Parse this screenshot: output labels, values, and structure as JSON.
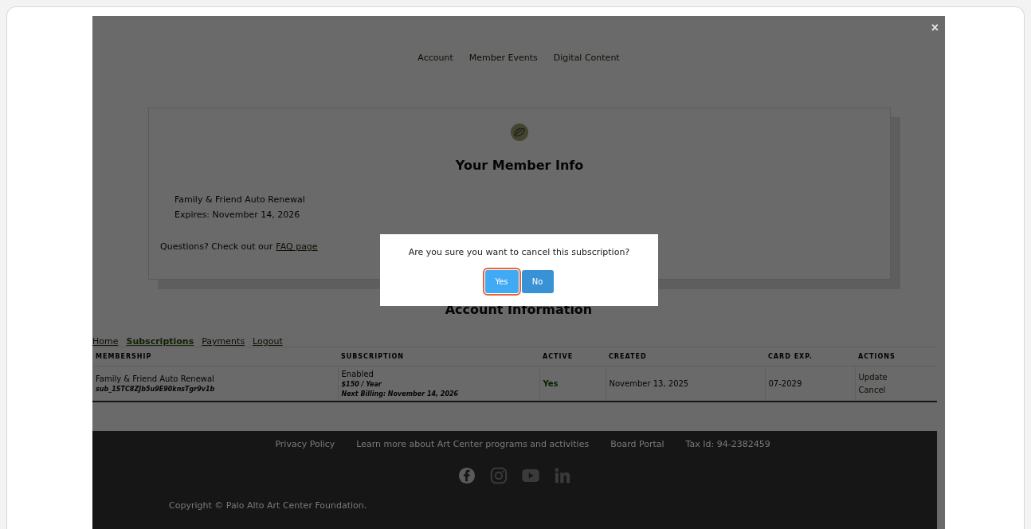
{
  "close_button": "×",
  "nav": [
    "Account",
    "Member Events",
    "Digital Content"
  ],
  "member_card": {
    "title": "Your Member Info",
    "lines": [
      "Family & Friend Auto Renewal",
      "Expires: November 14, 2026"
    ],
    "questions": "Questions? Check out our",
    "faq_link": "FAQ page"
  },
  "section_title": "Account Information",
  "tabs": [
    {
      "label": "Home",
      "selected": false
    },
    {
      "label": "Subscriptions",
      "selected": true
    },
    {
      "label": "Payments",
      "selected": false
    },
    {
      "label": "Logout",
      "selected": false
    }
  ],
  "table": {
    "columns": [
      "MEMBERSHIP",
      "SUBSCRIPTION",
      "ACTIVE",
      "CREATED",
      "CARD EXP.",
      "ACTIONS"
    ],
    "rows": [
      {
        "membership": "Family & Friend Auto Renewal",
        "subscription_id": "sub_1STC8ZJb5u9E90knsTgr9v1b",
        "status": "Enabled",
        "price": "$150 / Year",
        "next_billing": "Next Billing: November 14, 2026",
        "active": "Yes",
        "created": "November 13, 2025",
        "card_exp": "07-2029",
        "actions": [
          "Update",
          "Cancel"
        ]
      }
    ]
  },
  "footer": {
    "links": [
      "Privacy Policy",
      "Learn more about Art Center programs and activities",
      "Board Portal",
      "Tax Id: 94-2382459"
    ],
    "copyright": "Copyright © Palo Alto Art Center Foundation."
  },
  "dialog": {
    "message": "Are you sure you want to cancel this subscription?",
    "buttons": [
      {
        "label": "Yes",
        "focused": true
      },
      {
        "label": "No",
        "focused": false
      }
    ]
  }
}
